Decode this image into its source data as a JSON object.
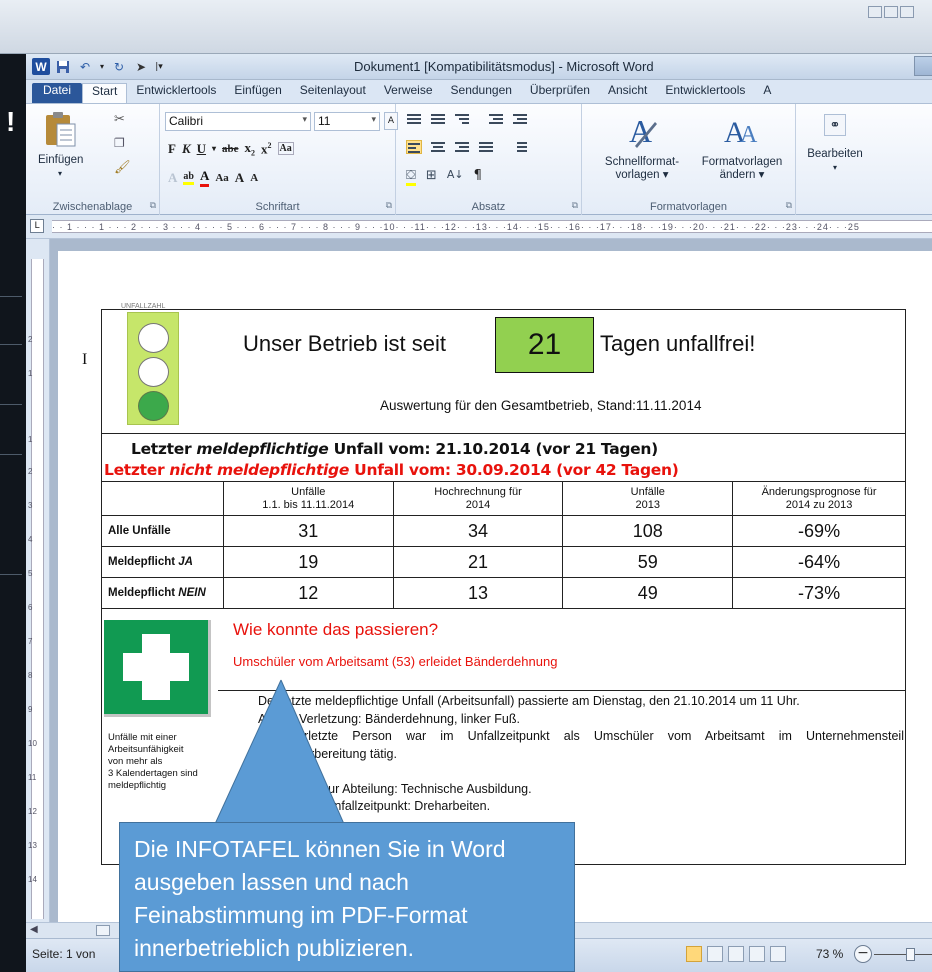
{
  "window": {
    "title": "Dokument1 [Kompatibilitätsmodus] - Microsoft Word",
    "app_icon": "W"
  },
  "tabs": [
    "Datei",
    "Start",
    "Entwicklertools",
    "Einfügen",
    "Seitenlayout",
    "Verweise",
    "Sendungen",
    "Überprüfen",
    "Ansicht",
    "Entwicklertools",
    "A"
  ],
  "ribbon": {
    "clipboard": {
      "paste_label": "Einfügen",
      "group": "Zwischenablage"
    },
    "font": {
      "name": "Calibri",
      "size": "11",
      "group": "Schriftart"
    },
    "paragraph": {
      "group": "Absatz"
    },
    "styles": {
      "quick_line1": "Schnellformat-",
      "quick_line2": "vorlagen",
      "change_line1": "Formatvorlagen",
      "change_line2": "ändern",
      "group": "Formatvorlagen"
    },
    "editing": {
      "label": "Bearbeiten"
    }
  },
  "ruler": {
    "text": "· · 1 · · · 1 · · · 2 · · · 3 · · · 4 · · · 5 · · · 6 · · · 7 · · · 8 · · · 9 · · ·10· · ·11· · ·12· · ·13· · ·14· · ·15· · ·16· · ·17· · ·18· · ·19· · ·20· · ·21· · ·22· · ·23· · ·24· · ·25",
    "vertical": [
      "2",
      "1",
      "1",
      "2",
      "3",
      "4",
      "5",
      "6",
      "7",
      "8",
      "9",
      "10",
      "11",
      "12",
      "13",
      "14",
      "15",
      "16"
    ]
  },
  "document": {
    "cursor": "I",
    "traffic_caption": "UNFALLZAHL",
    "headline_left": "Unser Betrieb ist seit",
    "days": "21",
    "headline_right": "Tagen unfallfrei!",
    "subhead": "Auswertung für den Gesamtbetrieb, Stand:11.11.2014",
    "last_reportable": {
      "pre": "Letzter ",
      "em": "meldepflichtige",
      "post": " Unfall vom: 21.10.2014 (vor 21 Tagen)"
    },
    "last_nonreportable": {
      "pre": "Letzter ",
      "em": "nicht meldepflichtige",
      "post": " Unfall vom: 30.09.2014 (vor 42 Tagen)"
    },
    "table": {
      "headers": [
        [
          "",
          ""
        ],
        [
          "Unfälle",
          "1.1. bis 11.11.2014"
        ],
        [
          "Hochrechnung für",
          "2014"
        ],
        [
          "Unfälle",
          "2013"
        ],
        [
          "Änderungsprognose für",
          "2014 zu 2013"
        ]
      ],
      "rows": [
        {
          "label": "Alle Unfälle",
          "label_em": "",
          "values": [
            "31",
            "34",
            "108",
            "-69%"
          ]
        },
        {
          "label": "Meldepflicht ",
          "label_em": "JA",
          "values": [
            "19",
            "21",
            "59",
            "-64%"
          ]
        },
        {
          "label": "Meldepflicht ",
          "label_em": "NEIN",
          "values": [
            "12",
            "13",
            "49",
            "-73%"
          ]
        }
      ]
    },
    "question": "Wie konnte das passieren?",
    "question_sub": "Umschüler vom Arbeitsamt (53)  erleidet Bänderdehnung",
    "first_aid_note": [
      "Unfälle mit einer",
      "Arbeitsunfähigkeit",
      "von mehr als",
      "3 Kalendertagen sind",
      "meldepflichtig"
    ],
    "body": [
      "Der letzte meldepflichtige Unfall (Arbeitsunfall) passierte am Dienstag, den 21.10.2014 um 11 Uhr.",
      "Art der Verletzung: Bänderdehnung, linker Fuß.",
      "Die verletzte Person war im Unfallzeitpunkt als Umschüler vom Arbeitsamt im Unternehmensteil",
      "Arbeitsvorbereitung tätig.",
      "",
      "Zuordnung zur Abteilung: Technische Ausbildung.",
      "Tätigkeit im Unfallzeitpunkt: Dreharbeiten."
    ]
  },
  "callout": {
    "lines": [
      "Die INFOTAFEL können Sie in Word",
      "ausgeben lassen und nach",
      "Feinabstimmung im PDF-Format",
      "innerbetrieblich publizieren."
    ]
  },
  "status": {
    "page": "Seite: 1 von",
    "zoom": "73 %"
  },
  "colors": {
    "accent_blue": "#2b579a",
    "days_box": "#92d050",
    "alert_red": "#e8120c",
    "callout": "#5b9bd5",
    "first_aid_green": "#119a52"
  }
}
